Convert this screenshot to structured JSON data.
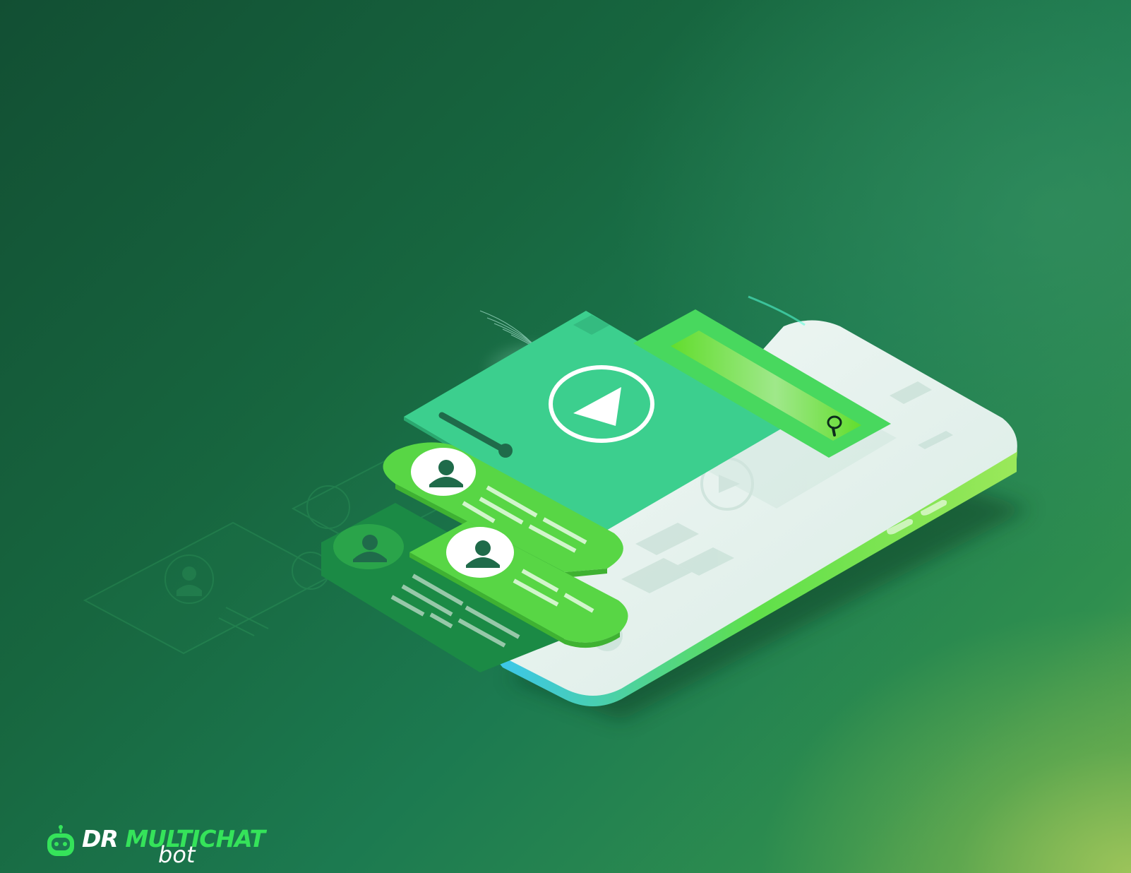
{
  "brand": {
    "name_part1": "DR",
    "name_part2": "MULTICHAT",
    "name_part3": "bot",
    "color_primary": "#35e35a",
    "color_text": "#ffffff"
  },
  "illustration": {
    "subject": "isometric smartphone with floating chat and video UI cards",
    "icons": [
      "play-icon",
      "search-icon",
      "user-avatar-icon",
      "robot-icon"
    ],
    "colors": {
      "background_dark": "#124f33",
      "background_light": "#9cc45a",
      "phone_body": "#e8f3ef",
      "phone_edge": "#54d93a",
      "card_teal": "#3ccf8e",
      "bubble_green": "#58d645",
      "bubble_dark": "#1b8a45"
    }
  }
}
